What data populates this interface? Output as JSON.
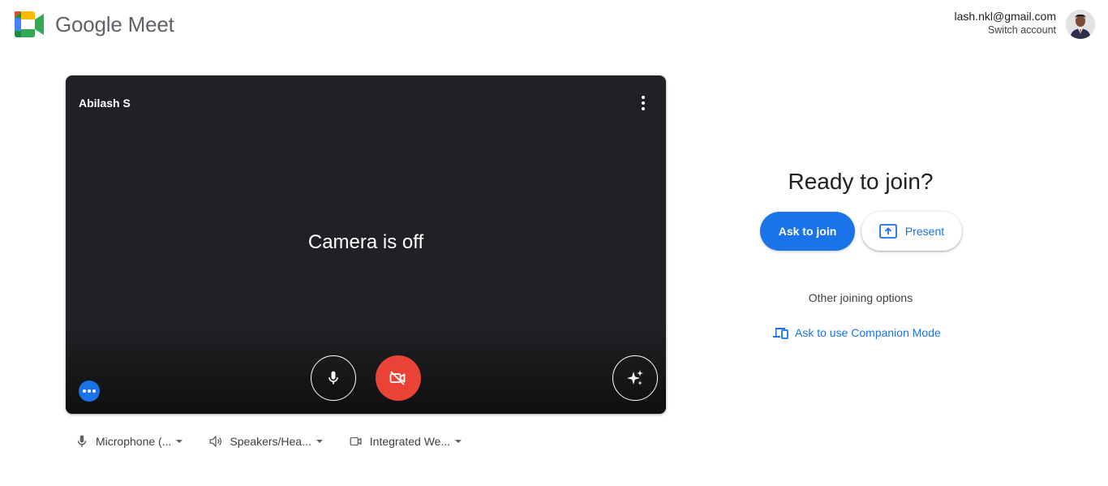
{
  "app": {
    "title": "Google Meet"
  },
  "account": {
    "email": "lash.nkl@gmail.com",
    "switch_label": "Switch account"
  },
  "preview": {
    "participant_name": "Abilash S",
    "status_text": "Camera is off"
  },
  "devices": {
    "microphone": "Microphone (...",
    "speakers": "Speakers/Hea...",
    "camera": "Integrated We..."
  },
  "join": {
    "title": "Ready to join?",
    "ask_to_join_label": "Ask to join",
    "present_label": "Present",
    "other_options_label": "Other joining options",
    "companion_label": "Ask to use Companion Mode"
  },
  "colors": {
    "accent": "#1a73e8",
    "camera_off_button": "#ea4335",
    "preview_bg": "#202124"
  },
  "icons": {
    "logo": "google-meet-logo",
    "more": "more-vert-icon",
    "mic": "microphone-icon",
    "camera_off": "videocam-off-icon",
    "effects": "sparkle-icon",
    "options": "more-horiz-icon",
    "speaker": "speaker-icon",
    "webcam": "videocam-icon",
    "present": "present-to-all-icon",
    "companion": "devices-icon"
  }
}
